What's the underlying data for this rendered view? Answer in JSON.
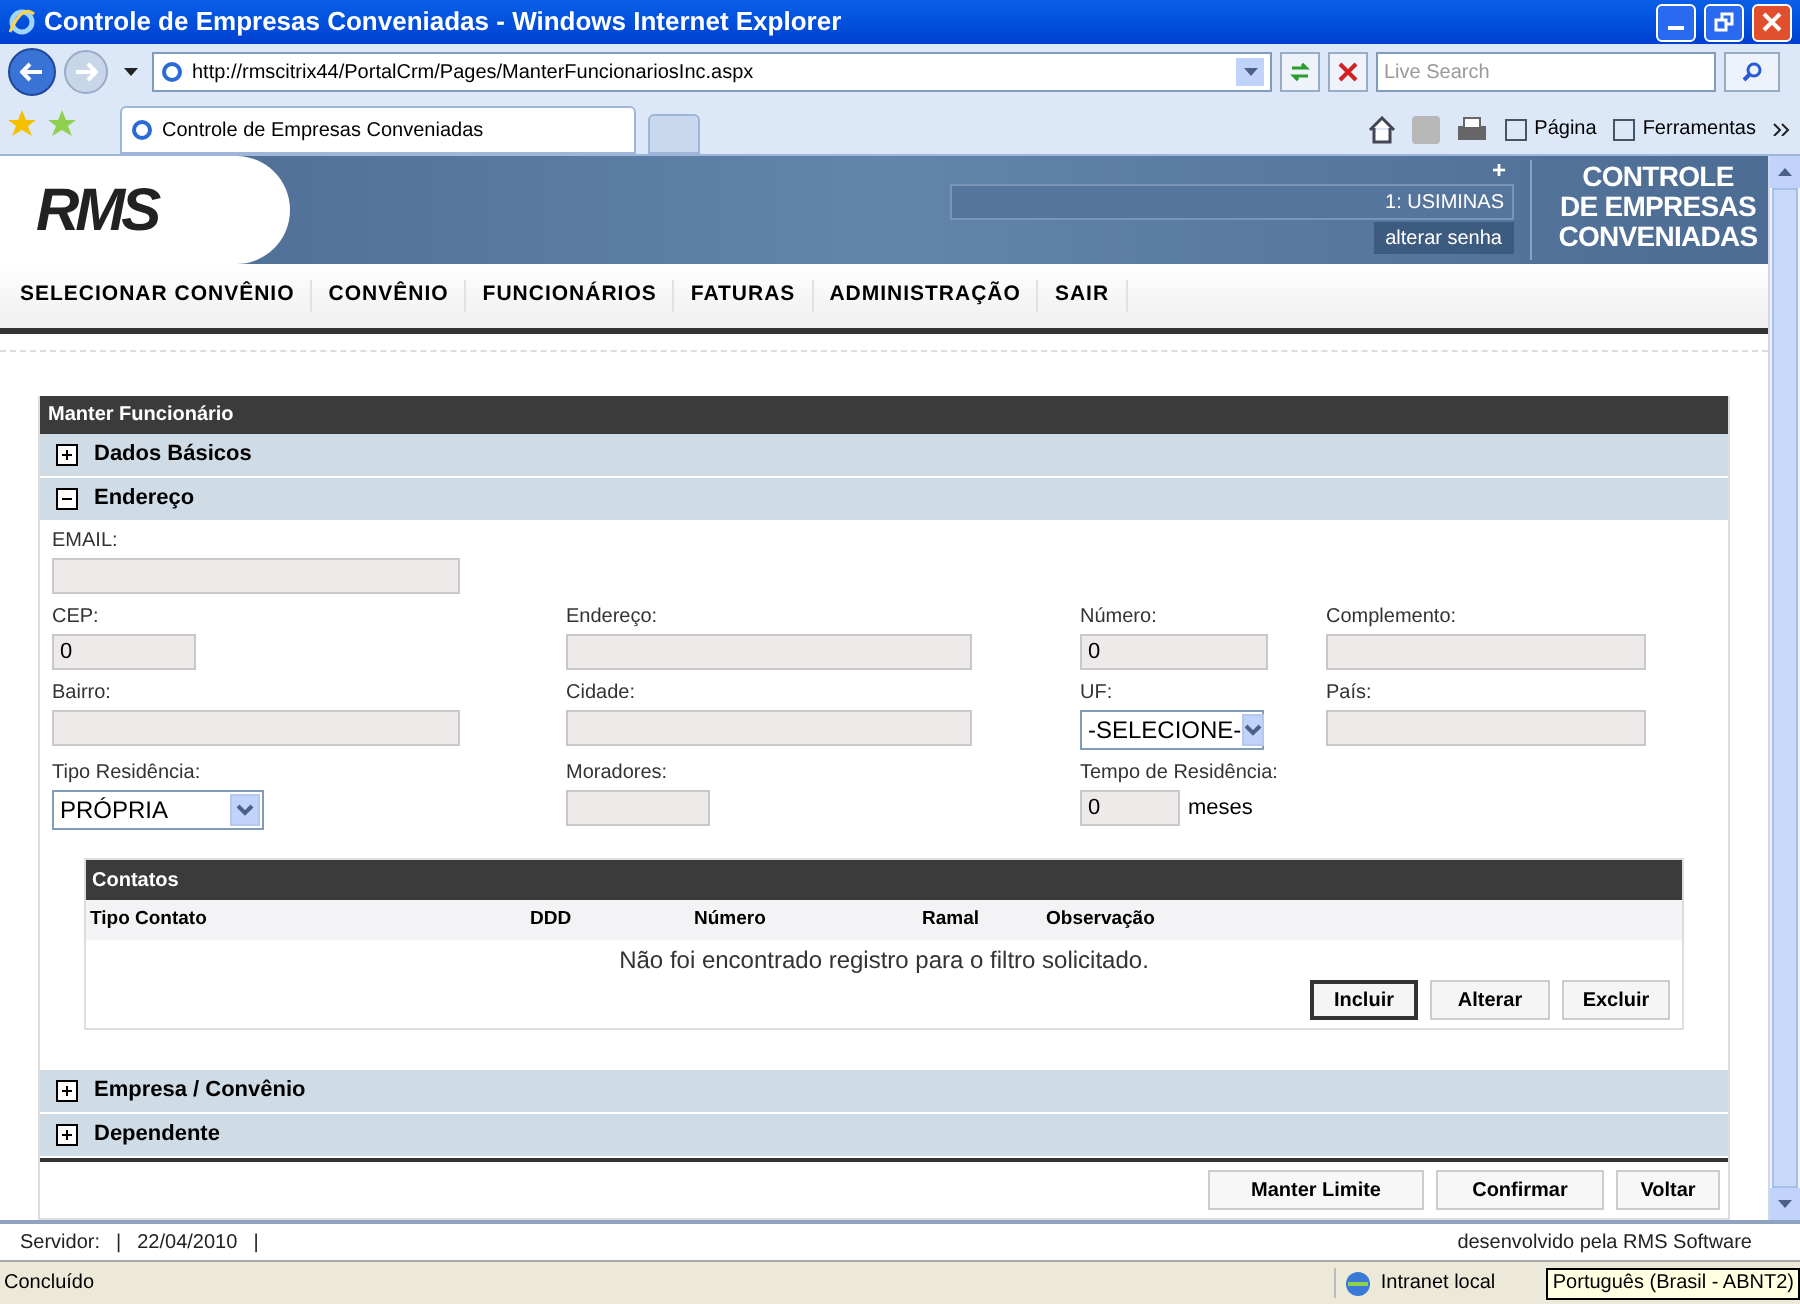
{
  "window": {
    "title": "Controle de Empresas Conveniadas - Windows Internet Explorer"
  },
  "address": {
    "url": "http://rmscitrix44/PortalCrm/Pages/ManterFuncionariosInc.aspx"
  },
  "search": {
    "placeholder": "Live Search"
  },
  "tab": {
    "title": "Controle de Empresas Conveniadas"
  },
  "toolbar": [
    "Página",
    "Ferramentas"
  ],
  "header": {
    "logo": "RMS",
    "plus": "+",
    "user": "1: USIMINAS",
    "change_password": "alterar senha",
    "app_title": [
      "CONTROLE",
      "DE EMPRESAS",
      "CONVENIADAS"
    ]
  },
  "nav": [
    "SELECIONAR CONVÊNIO",
    "CONVÊNIO",
    "FUNCIONÁRIOS",
    "FATURAS",
    "ADMINISTRAÇÃO",
    "SAIR"
  ],
  "panel": {
    "title": "Manter Funcionário",
    "sections": [
      {
        "label": "Dados Básicos",
        "expanded": false
      },
      {
        "label": "Endereço",
        "expanded": true
      },
      {
        "label": "Empresa / Convênio",
        "expanded": false
      },
      {
        "label": "Dependente",
        "expanded": false
      }
    ],
    "form_rows": [
      [
        {
          "kind": "text",
          "label": "EMAIL:"
        }
      ],
      [
        {
          "kind": "text",
          "label": "CEP:",
          "value": "0"
        },
        {
          "kind": "text",
          "label": "Endereço:"
        },
        {
          "kind": "text",
          "label": "Número:",
          "value": "0"
        },
        {
          "kind": "text",
          "label": "Complemento:"
        }
      ],
      [
        {
          "kind": "text",
          "label": "Bairro:"
        },
        {
          "kind": "text",
          "label": "Cidade:"
        },
        {
          "kind": "select",
          "label": "UF:",
          "value": "-SELECIONE-"
        },
        {
          "kind": "text",
          "label": "País:"
        }
      ],
      [
        {
          "kind": "select",
          "label": "Tipo Residência:",
          "value": "PRÓPRIA"
        },
        {
          "kind": "text",
          "label": "Moradores:"
        },
        {
          "kind": "text",
          "label": "Tempo de Residência:",
          "value": "0",
          "suffix": "meses"
        }
      ]
    ],
    "contacts": {
      "title": "Contatos",
      "columns": [
        "Tipo Contato",
        "DDD",
        "Número",
        "Ramal",
        "Observação"
      ],
      "empty_message": "Não foi encontrado registro para o filtro solicitado.",
      "buttons": [
        {
          "label": "Incluir",
          "selected": true
        },
        {
          "label": "Alterar",
          "selected": false
        },
        {
          "label": "Excluir",
          "selected": false
        }
      ]
    },
    "actions": [
      "Manter Limite",
      "Confirmar",
      "Voltar"
    ]
  },
  "footer": {
    "server": "Servidor:",
    "sep1": "|",
    "date": "22/04/2010",
    "sep2": "|",
    "credit": "desenvolvido pela RMS Software"
  },
  "status_bar": {
    "text": "Concluído",
    "zone": "Intranet local",
    "tooltip": "Português (Brasil - ABNT2)"
  }
}
